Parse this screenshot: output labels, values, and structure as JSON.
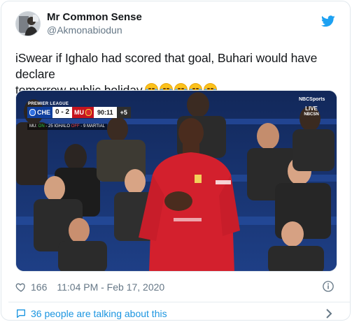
{
  "tweet": {
    "display_name": "Mr Common Sense",
    "handle": "@Akmonabiodun",
    "text_line1": "iSwear if Ighalo had scored that goal, Buhari would have declare",
    "text_line2": "tomorrow public holiday",
    "emojis": [
      "loudly-crying-face",
      "loudly-crying-face",
      "face-with-tears-of-joy",
      "face-with-tears-of-joy",
      "face-with-tears-of-joy"
    ],
    "like_count": "166",
    "timestamp": "11:04 PM - Feb 17, 2020",
    "talking_text": "36 people are talking about this"
  },
  "scorebug": {
    "league": "PREMIER LEAGUE",
    "home_team": "CHE",
    "home_score": "0",
    "separator": "-",
    "away_score": "2",
    "away_team": "MU",
    "clock": "90:11",
    "added_time": "+5",
    "subs_team": "MU:",
    "subs_on": "ON",
    "subs_on_player": "- 25 IGHALO",
    "subs_off": "OFF",
    "subs_off_player": "- 9 MARTIAL",
    "network_top": "NBCSports",
    "network_live": "LIVE",
    "network_bottom": "NBCSN"
  },
  "colors": {
    "brand_blue": "#1da1f2",
    "link_blue": "#1b95e0",
    "muted": "#657786",
    "text": "#14171a",
    "mu_red": "#c5141f",
    "chelsea_blue": "#0f3f9e"
  },
  "icons": {
    "logo": "twitter-bird-icon",
    "like": "heart-icon",
    "info": "info-icon",
    "conversation": "chat-bubble-icon",
    "navigate": "chevron-right-icon"
  }
}
